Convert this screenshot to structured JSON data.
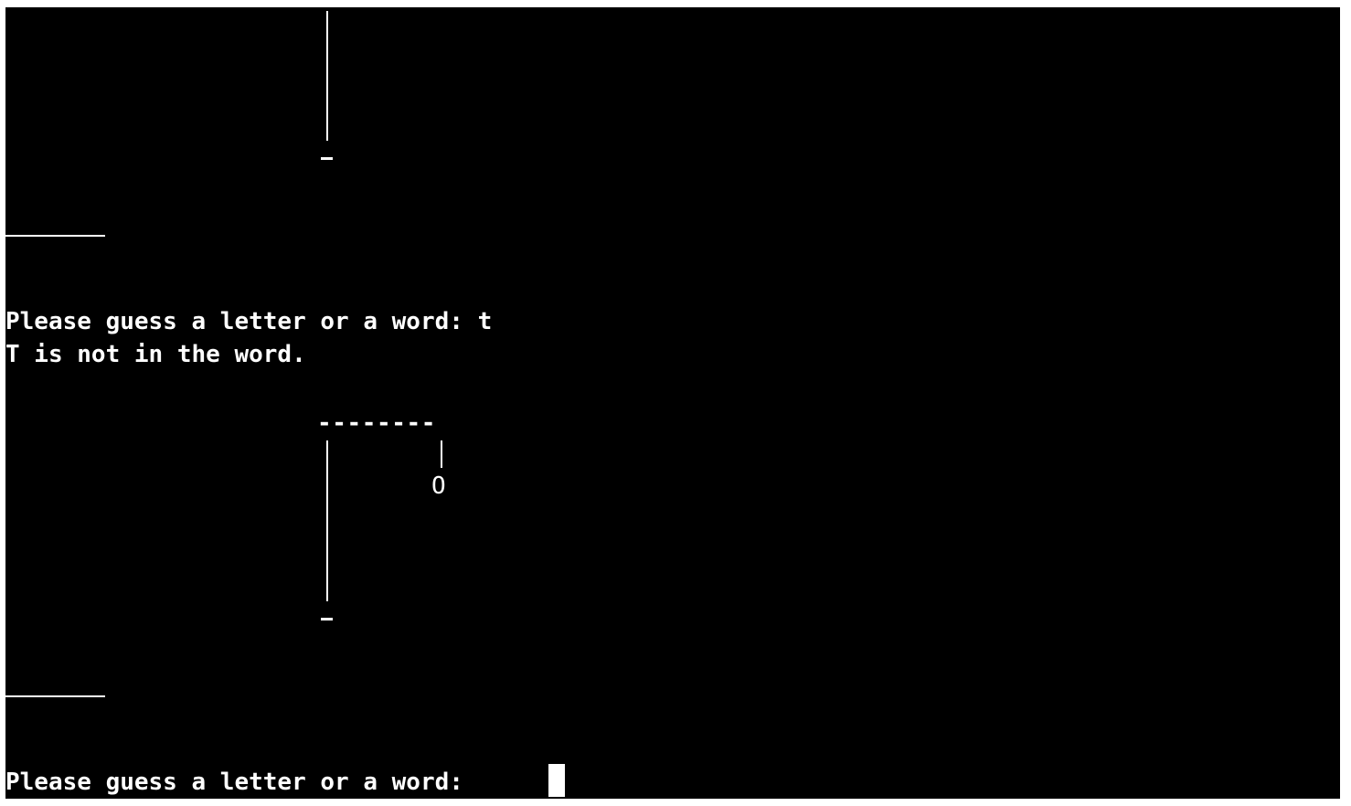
{
  "terminal": {
    "history": [
      {
        "prompt": "Please guess a letter or a word: ",
        "input": "t",
        "response": "T is not in the word."
      }
    ],
    "gallows": {
      "top_beam": "--------",
      "head": "O"
    },
    "current_prompt": "Please guess a letter or a word: ",
    "colors": {
      "background": "#000000",
      "text": "#ffffff"
    },
    "icons": {
      "cursor": "block-cursor"
    }
  }
}
